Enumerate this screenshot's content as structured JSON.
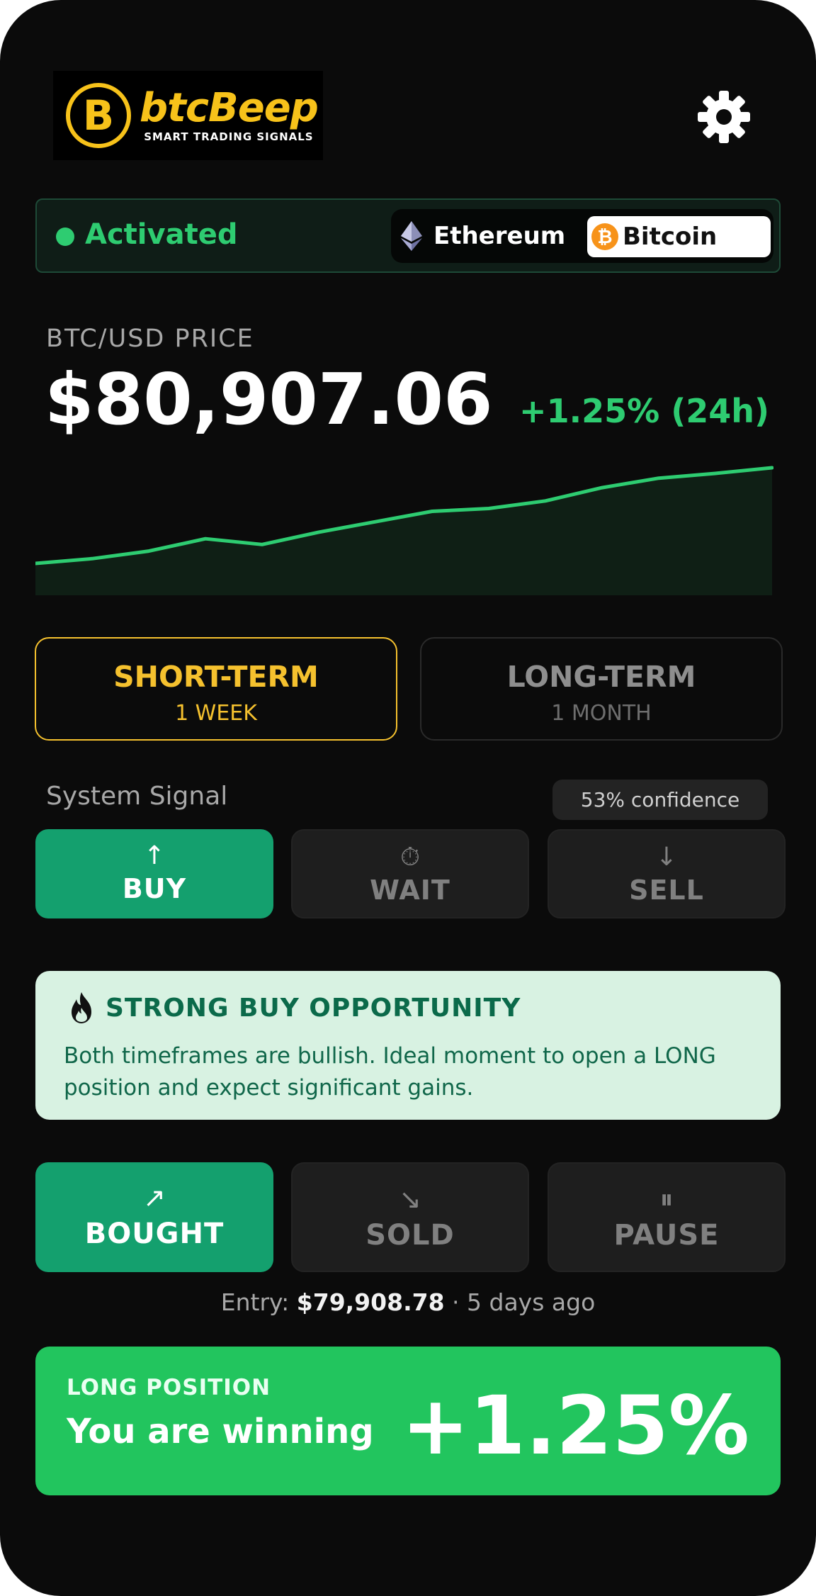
{
  "app": {
    "logo_name": "btcBeep",
    "logo_tagline": "SMART TRADING SIGNALS",
    "logo_coin_glyph": "B"
  },
  "header": {
    "settings_icon": "gear-icon"
  },
  "status": {
    "text": "Activated",
    "color": "#2ecc71"
  },
  "assets": {
    "ethereum_label": "Ethereum",
    "bitcoin_label": "Bitcoin",
    "bitcoin_glyph": "₿",
    "selected": "Bitcoin"
  },
  "price": {
    "label": "BTC/USD PRICE",
    "value": "$80,907.06",
    "change": "+1.25% (24h)",
    "sparkline": [
      79910,
      79960,
      80040,
      80170,
      80110,
      80240,
      80350,
      80460,
      80490,
      80570,
      80710,
      80810,
      80860,
      80920
    ]
  },
  "terms": {
    "short_title": "SHORT-TERM",
    "short_sub": "1 WEEK",
    "long_title": "LONG-TERM",
    "long_sub": "1 MONTH",
    "selected": "short"
  },
  "signal": {
    "label": "System Signal",
    "confidence": "53% confidence",
    "buy_icon": "↑",
    "buy_label": "BUY",
    "wait_icon": "⏱",
    "wait_label": "WAIT",
    "sell_icon": "↓",
    "sell_label": "SELL",
    "selected": "BUY"
  },
  "opportunity": {
    "title": "STRONG BUY OPPORTUNITY",
    "text": "Both timeframes are bullish. Ideal moment to open a LONG position and expect significant gains."
  },
  "actions": {
    "bought_icon": "↗",
    "bought_label": "BOUGHT",
    "sold_icon": "↘",
    "sold_label": "SOLD",
    "pause_icon": "⏸",
    "pause_label": "PAUSE",
    "selected": "BOUGHT"
  },
  "entry": {
    "prefix": "Entry:",
    "price": "$79,908.78",
    "separator": "·",
    "age": "5 days ago"
  },
  "position": {
    "label": "LONG POSITION",
    "status": "You are winning",
    "percent": "+1.25%"
  },
  "colors": {
    "accent_green": "#22c55e",
    "buy_green": "#14a06e",
    "gold": "#f5c12e",
    "background": "#0b0b0b"
  }
}
